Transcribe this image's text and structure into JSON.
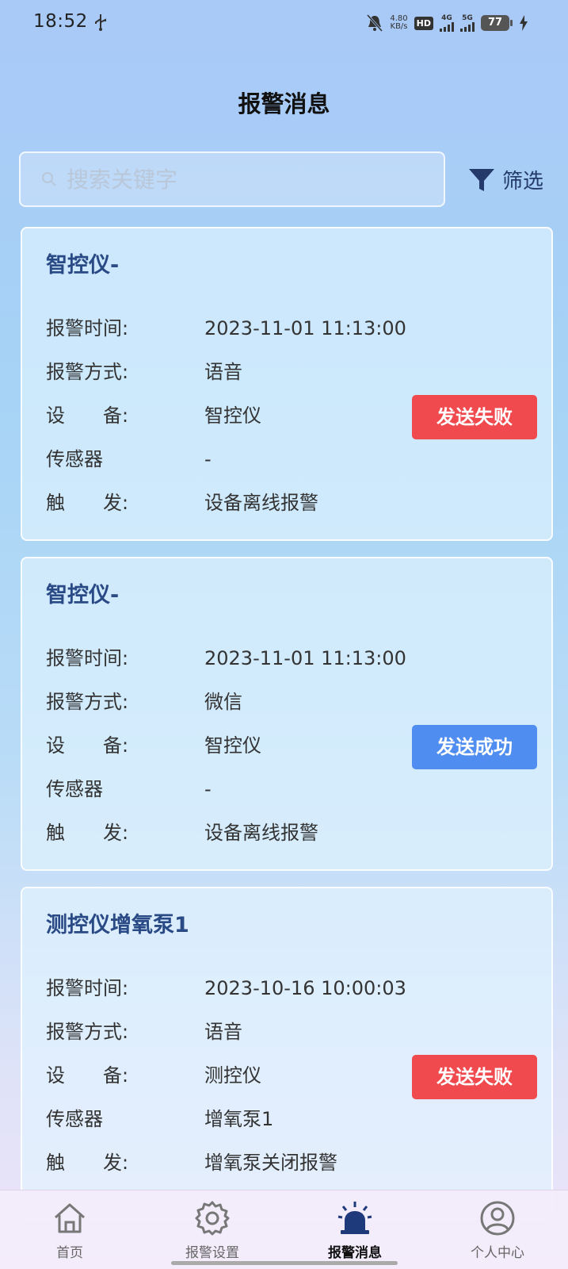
{
  "status_bar": {
    "time": "18:52",
    "net_speed_value": "4.80",
    "net_speed_unit": "KB/s",
    "hd_label": "HD",
    "signal1_label": "4G",
    "signal2_label": "5G",
    "battery": "77"
  },
  "header": {
    "title": "报警消息"
  },
  "search": {
    "placeholder": "搜索关键字",
    "value": ""
  },
  "filter": {
    "label": "筛选"
  },
  "cards": [
    {
      "title": "智控仪-",
      "fields": [
        {
          "label": "报警时间:",
          "value": "2023-11-01 11:13:00"
        },
        {
          "label": "报警方式:",
          "value": "语音"
        },
        {
          "label": "设　　备:",
          "value": "智控仪"
        },
        {
          "label": "传感器",
          "value": "-"
        },
        {
          "label": "触　　发:",
          "value": "设备离线报警"
        }
      ],
      "status": "发送失败",
      "status_type": "fail"
    },
    {
      "title": "智控仪-",
      "fields": [
        {
          "label": "报警时间:",
          "value": "2023-11-01 11:13:00"
        },
        {
          "label": "报警方式:",
          "value": "微信"
        },
        {
          "label": "设　　备:",
          "value": "智控仪"
        },
        {
          "label": "传感器",
          "value": "-"
        },
        {
          "label": "触　　发:",
          "value": "设备离线报警"
        }
      ],
      "status": "发送成功",
      "status_type": "success"
    },
    {
      "title": "测控仪增氧泵1",
      "fields": [
        {
          "label": "报警时间:",
          "value": "2023-10-16 10:00:03"
        },
        {
          "label": "报警方式:",
          "value": "语音"
        },
        {
          "label": "设　　备:",
          "value": "测控仪"
        },
        {
          "label": "传感器",
          "value": "增氧泵1"
        },
        {
          "label": "触　　发:",
          "value": "增氧泵关闭报警"
        }
      ],
      "status": "发送失败",
      "status_type": "fail"
    }
  ],
  "tabs": [
    {
      "label": "首页",
      "icon": "home-icon",
      "active": false
    },
    {
      "label": "报警设置",
      "icon": "gear-icon",
      "active": false
    },
    {
      "label": "报警消息",
      "icon": "alarm-light-icon",
      "active": true
    },
    {
      "label": "个人中心",
      "icon": "user-icon",
      "active": false
    }
  ],
  "colors": {
    "fail": "#f14a4e",
    "success": "#4f8ef0",
    "card_title": "#2a4a86"
  }
}
